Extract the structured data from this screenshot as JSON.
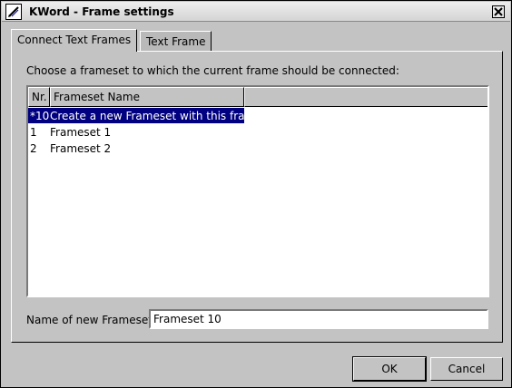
{
  "window": {
    "title": "KWord - Frame settings",
    "icon": "pen-icon",
    "close": "close-icon"
  },
  "tabs": [
    {
      "label": "Connect Text Frames",
      "active": true
    },
    {
      "label": "Text Frame",
      "active": false
    }
  ],
  "prompt": "Choose a frameset to which the current frame should be connected:",
  "list": {
    "columns": [
      "Nr.",
      "Frameset Name"
    ],
    "rows": [
      {
        "nr": "*10",
        "name": "Create a new Frameset with this frame",
        "selected": true
      },
      {
        "nr": "1",
        "name": "Frameset 1",
        "selected": false
      },
      {
        "nr": "2",
        "name": "Frameset 2",
        "selected": false
      }
    ]
  },
  "name_field": {
    "label": "Name of new Frameset:",
    "value": "Frameset 10"
  },
  "buttons": {
    "ok": "OK",
    "cancel": "Cancel"
  },
  "colors": {
    "selection": "#000080",
    "background": "#c3c3c3"
  }
}
